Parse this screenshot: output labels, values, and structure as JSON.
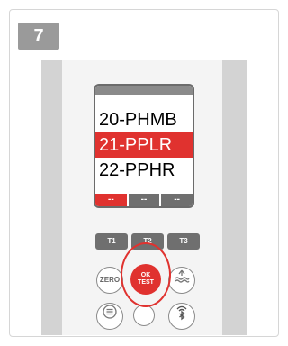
{
  "step": {
    "number": "7"
  },
  "screen": {
    "items": [
      "20-PHMB",
      "21-PPLR",
      "22-PPHR"
    ],
    "softkeys": [
      "--",
      "--",
      "--"
    ]
  },
  "keys": {
    "t1": "T1",
    "t2": "T2",
    "t3": "T3",
    "zero": "ZERO",
    "ok_line1": "OK",
    "ok_line2": "TEST"
  },
  "icons": {
    "tide": "tide-icon",
    "menu": "menu-icon",
    "bluetooth": "bluetooth-wireless-icon"
  },
  "colors": {
    "accent": "#e0322f",
    "key_gray": "#6f6f6f",
    "device_gray": "#d3d3d3"
  }
}
